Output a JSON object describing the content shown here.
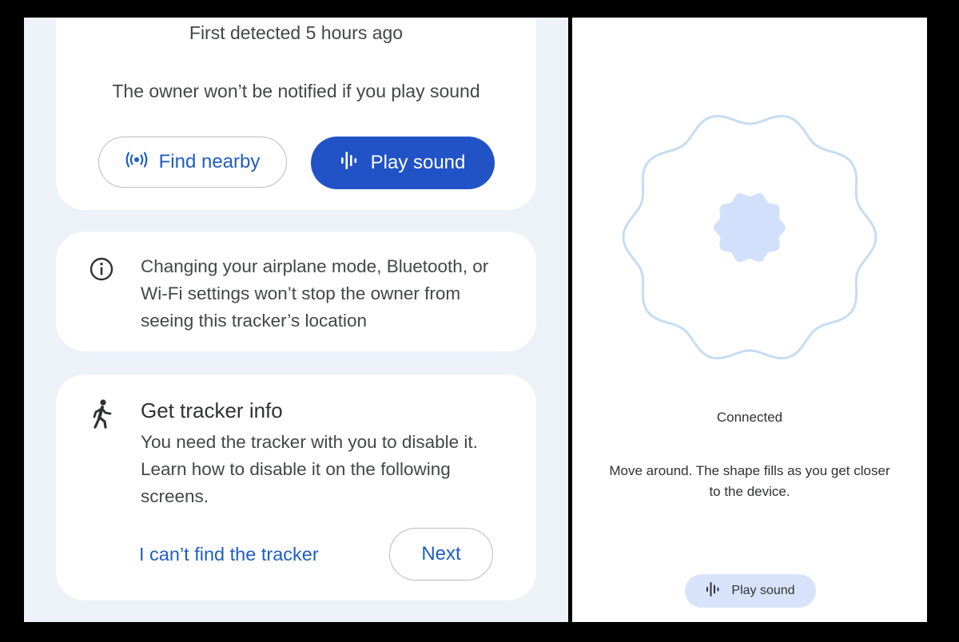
{
  "left_screen": {
    "detected_text": "First detected 5 hours ago",
    "notice_text": "The owner won’t be notified if you play sound",
    "find_nearby_label": "Find nearby",
    "play_sound_label": "Play sound",
    "info_card": {
      "icon": "info-icon",
      "text": "Changing your airplane mode, Bluetooth, or Wi-Fi settings won’t stop the owner from seeing this tracker’s location"
    },
    "tracker_card": {
      "icon": "walking-person-icon",
      "title": "Get tracker info",
      "text": "You need the tracker with you to disable it. Learn how to disable it on the following screens.",
      "cant_find_label": "I can’t find the tracker",
      "next_label": "Next"
    }
  },
  "right_screen": {
    "status_text": "Connected",
    "instruction_text": "Move around. The shape fills as you get closer to the device.",
    "play_sound_label": "Play sound"
  },
  "colors": {
    "accent": "#2153c7",
    "link": "#1f5ec4",
    "left_background": "#edf1f8",
    "shape_outline": "#c5ddf3",
    "shape_fill": "#d3e0fb",
    "chip_background": "#d8e3fb"
  }
}
